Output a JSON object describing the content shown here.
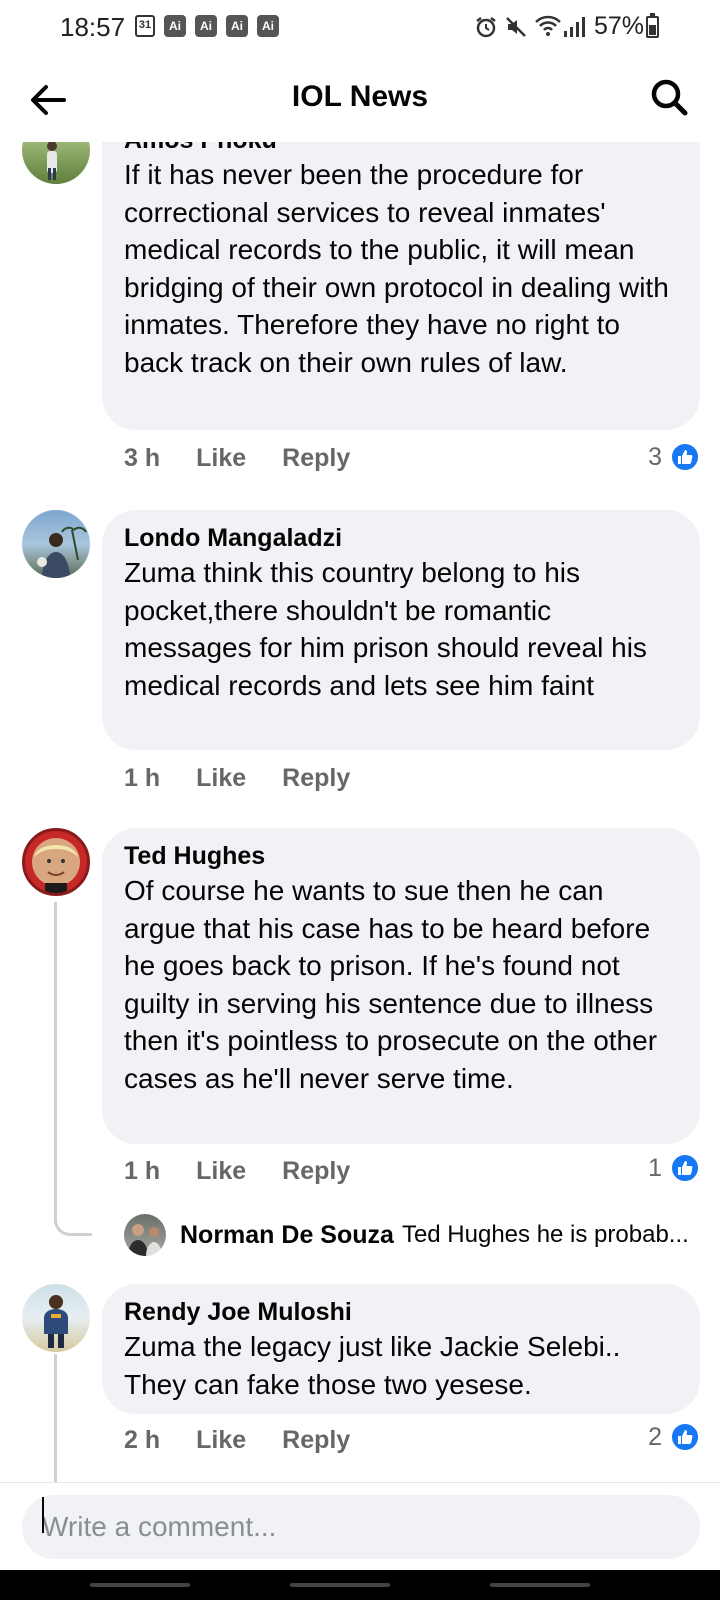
{
  "status_bar": {
    "time": "18:57",
    "calendar_day": "31",
    "ai_badges": [
      "Ai",
      "Ai",
      "Ai",
      "Ai"
    ],
    "battery": "57%",
    "icons": [
      "alarm-icon",
      "mute-icon",
      "wifi-icon",
      "signal-icon",
      "battery-icon"
    ]
  },
  "header": {
    "title": "IOL News",
    "back_icon": "arrow-left-icon",
    "search_icon": "search-icon"
  },
  "comments": [
    {
      "author": "Amos Phoku",
      "text": "If it has never been the procedure for correctional services to reveal inmates' medical records to the public, it will mean bridging of their own protocol in dealing with inmates. Therefore they have no right to back track on their own rules of law.",
      "time": "3 h",
      "like_label": "Like",
      "reply_label": "Reply",
      "reactions": "3"
    },
    {
      "author": "Londo Mangaladzi",
      "text": "Zuma think this country belong to his pocket,there shouldn't be romantic messages for him prison should reveal his medical records and lets see him faint",
      "time": "1 h",
      "like_label": "Like",
      "reply_label": "Reply",
      "reactions": ""
    },
    {
      "author": "Ted Hughes",
      "text": "Of course he wants to sue then he can argue that his case has to be heard before he goes back to prison. If he's found not guilty in serving his sentence due to illness then it's pointless to prosecute on the other cases as he'll never serve time.",
      "time": "1 h",
      "like_label": "Like",
      "reply_label": "Reply",
      "reactions": "1",
      "reply_preview": {
        "author": "Norman De Souza",
        "text": "Ted Hughes he is probab..."
      }
    },
    {
      "author": "Rendy Joe Muloshi",
      "text": "Zuma the legacy just like Jackie Selebi.. They can fake those two yesese.",
      "time": "2 h",
      "like_label": "Like",
      "reply_label": "Reply",
      "reactions": "2"
    }
  ],
  "composer": {
    "placeholder": "Write a comment..."
  },
  "colors": {
    "bubble": "#f0f2f5",
    "meta_text": "#65676b",
    "like_blue": "#1877f2"
  }
}
